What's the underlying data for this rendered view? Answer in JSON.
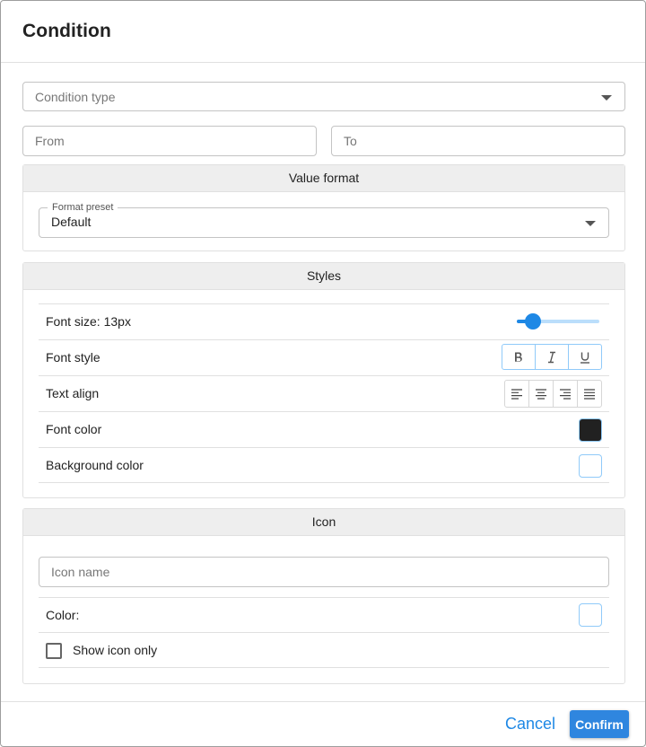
{
  "dialog": {
    "title": "Condition",
    "condition_type_placeholder": "Condition type",
    "from_placeholder": "From",
    "to_placeholder": "To"
  },
  "value_format": {
    "header": "Value format",
    "preset_label": "Format preset",
    "preset_value": "Default"
  },
  "styles": {
    "header": "Styles",
    "font_size_label": "Font size: 13px",
    "font_size_slider_fraction": 0.2,
    "font_style_label": "Font style",
    "font_style_buttons": [
      "bold-icon",
      "italic-icon",
      "underline-icon"
    ],
    "text_align_label": "Text align",
    "text_align_buttons": [
      "align-left-icon",
      "align-center-icon",
      "align-right-icon",
      "align-justify-icon"
    ],
    "font_color_label": "Font color",
    "font_color": "#212121",
    "background_color_label": "Background color",
    "background_color": "#ffffff"
  },
  "icon_section": {
    "header": "Icon",
    "icon_name_placeholder": "Icon name",
    "color_label": "Color:",
    "color": "#ffffff",
    "show_icon_only_label": "Show icon only",
    "show_icon_only_checked": false
  },
  "footer": {
    "cancel_label": "Cancel",
    "confirm_label": "Confirm"
  },
  "colors": {
    "accent": "#2f86df",
    "slider": "#1e88e5",
    "slider_track": "#bbdefb"
  }
}
